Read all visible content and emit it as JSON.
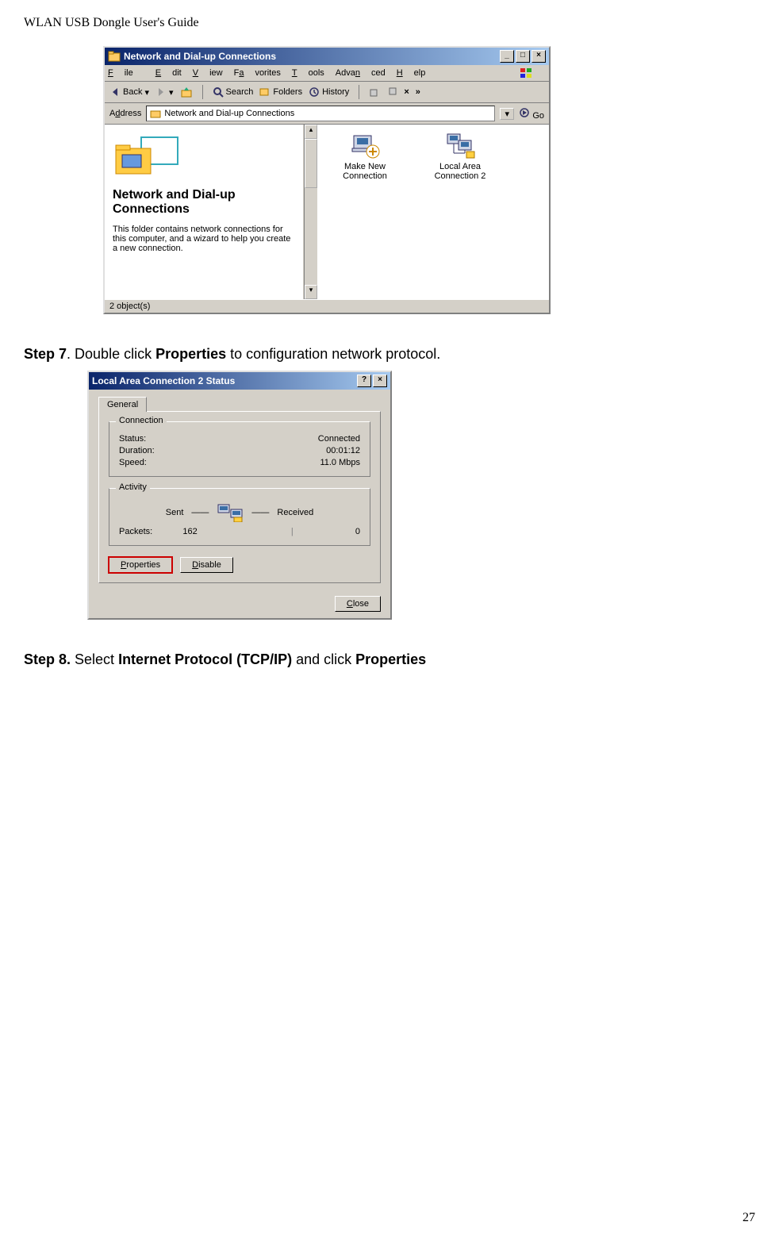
{
  "doc_header": "WLAN USB Dongle User's Guide",
  "page_number": "27",
  "window1": {
    "title": "Network and Dial-up Connections",
    "menus": {
      "file": "File",
      "edit": "Edit",
      "view": "View",
      "favorites": "Favorites",
      "tools": "Tools",
      "advanced": "Advanced",
      "help": "Help"
    },
    "toolbar": {
      "back": "Back",
      "search": "Search",
      "folders": "Folders",
      "history": "History"
    },
    "address_label": "Address",
    "address_value": "Network and Dial-up Connections",
    "go": "Go",
    "left_title": "Network and Dial-up Connections",
    "left_desc": "This folder contains network connections for this computer, and a wizard to help you create a new connection.",
    "item1": "Make New Connection",
    "item2": "Local Area Connection 2",
    "status": "2 object(s)"
  },
  "step7": {
    "label": "Step 7",
    "text_before": ".     Double click ",
    "bold": "Properties",
    "text_after": " to configuration network protocol."
  },
  "dialog": {
    "title": "Local Area Connection 2 Status",
    "tab": "General",
    "group1": {
      "legend": "Connection",
      "status_label": "Status:",
      "status_value": "Connected",
      "duration_label": "Duration:",
      "duration_value": "00:01:12",
      "speed_label": "Speed:",
      "speed_value": "11.0 Mbps"
    },
    "group2": {
      "legend": "Activity",
      "sent": "Sent",
      "received": "Received",
      "packets_label": "Packets:",
      "packets_sent": "162",
      "packets_recv": "0"
    },
    "btn_props": "Properties",
    "btn_disable": "Disable",
    "btn_close": "Close"
  },
  "step8": {
    "label": "Step 8.",
    "text_before": "   Select ",
    "bold1": "Internet Protocol (TCP/IP)",
    "mid": " and click ",
    "bold2": "Properties"
  }
}
